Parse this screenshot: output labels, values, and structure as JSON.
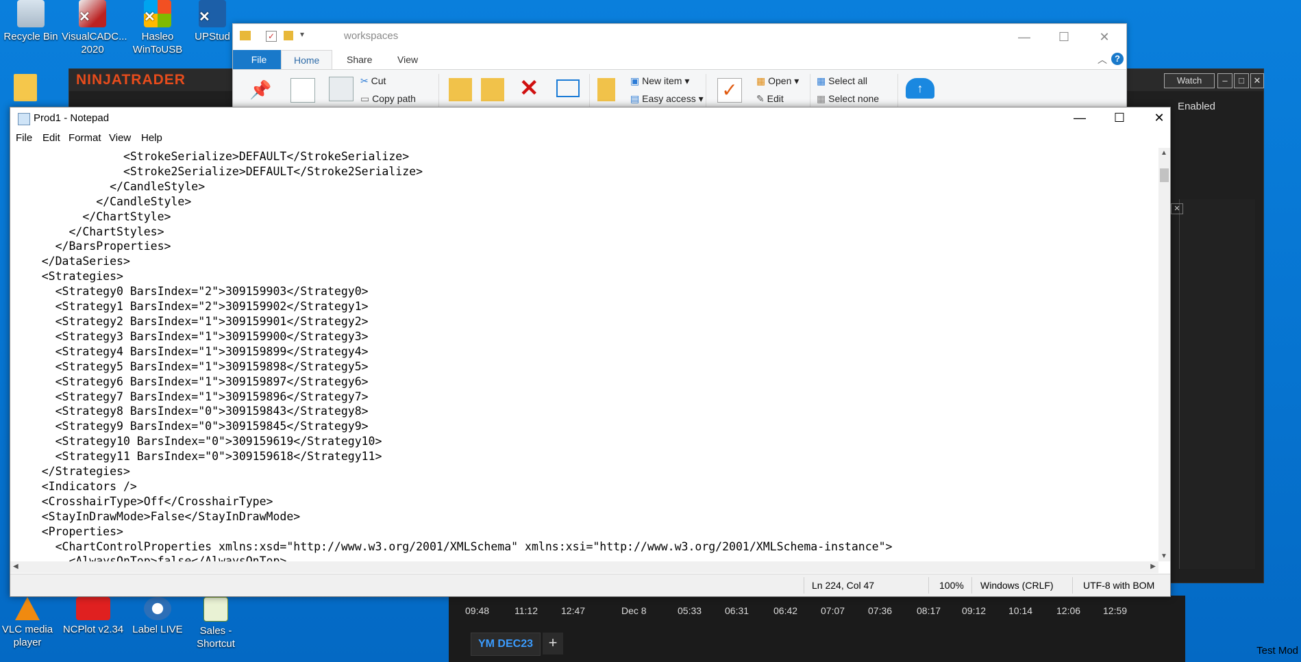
{
  "desktop": {
    "icons_left": [
      {
        "label": "Recycle Bin"
      },
      {
        "label": "VisualCADC...\n2020"
      },
      {
        "label": "Hasleo\nWinToUSB"
      },
      {
        "label": "UPStud"
      }
    ],
    "icons_bottom": [
      {
        "label": "VLC media\nplayer"
      },
      {
        "label": "NCPlot v2.34"
      },
      {
        "label": "Label LIVE"
      },
      {
        "label": "Sales -\nShortcut"
      }
    ],
    "watermark": "Test Mod"
  },
  "ninjatrader": {
    "title": "NINJATRADER",
    "watch_label": "Watch",
    "enabled_label": "Enabled",
    "time_ticks": [
      "09:48",
      "11:12",
      "12:47",
      "Dec 8",
      "05:33",
      "06:31",
      "06:42",
      "07:07",
      "07:36",
      "08:17",
      "09:12",
      "10:14",
      "12:06",
      "12:59"
    ],
    "chart_tab": "YM DEC23",
    "add_tab": "+"
  },
  "explorer": {
    "title": "workspaces",
    "tabs": [
      "File",
      "Home",
      "Share",
      "View"
    ],
    "ribbon": {
      "cut": "Cut",
      "copy_path": "Copy path",
      "new_item": "New item",
      "easy_access": "Easy access",
      "open": "Open",
      "edit": "Edit",
      "select_all": "Select all",
      "select_none": "Select none"
    }
  },
  "notepad": {
    "title": "Prod1 - Notepad",
    "menu": [
      "File",
      "Edit",
      "Format",
      "View",
      "Help"
    ],
    "lines": [
      "                <StrokeSerialize>DEFAULT</StrokeSerialize>",
      "                <Stroke2Serialize>DEFAULT</Stroke2Serialize>",
      "              </CandleStyle>",
      "            </CandleStyle>",
      "          </ChartStyle>",
      "        </ChartStyles>",
      "      </BarsProperties>",
      "    </DataSeries>",
      "    <Strategies>",
      "      <Strategy0 BarsIndex=\"2\">309159903</Strategy0>",
      "      <Strategy1 BarsIndex=\"2\">309159902</Strategy1>",
      "      <Strategy2 BarsIndex=\"1\">309159901</Strategy2>",
      "      <Strategy3 BarsIndex=\"1\">309159900</Strategy3>",
      "      <Strategy4 BarsIndex=\"1\">309159899</Strategy4>",
      "      <Strategy5 BarsIndex=\"1\">309159898</Strategy5>",
      "      <Strategy6 BarsIndex=\"1\">309159897</Strategy6>",
      "      <Strategy7 BarsIndex=\"1\">309159896</Strategy7>",
      "      <Strategy8 BarsIndex=\"0\">309159843</Strategy8>",
      "      <Strategy9 BarsIndex=\"0\">309159845</Strategy9>",
      "      <Strategy10 BarsIndex=\"0\">309159619</Strategy10>",
      "      <Strategy11 BarsIndex=\"0\">309159618</Strategy11>",
      "    </Strategies>",
      "    <Indicators />",
      "    <CrosshairType>Off</CrosshairType>",
      "    <StayInDrawMode>False</StayInDrawMode>",
      "    <Properties>",
      "      <ChartControlProperties xmlns:xsd=\"http://www.w3.org/2001/XMLSchema\" xmlns:xsi=\"http://www.w3.org/2001/XMLSchema-instance\">",
      "        <AlwaysOnTop>false</AlwaysOnTop>"
    ],
    "status": {
      "position": "Ln 224, Col 47",
      "zoom": "100%",
      "line_endings": "Windows (CRLF)",
      "encoding": "UTF-8 with BOM"
    }
  }
}
